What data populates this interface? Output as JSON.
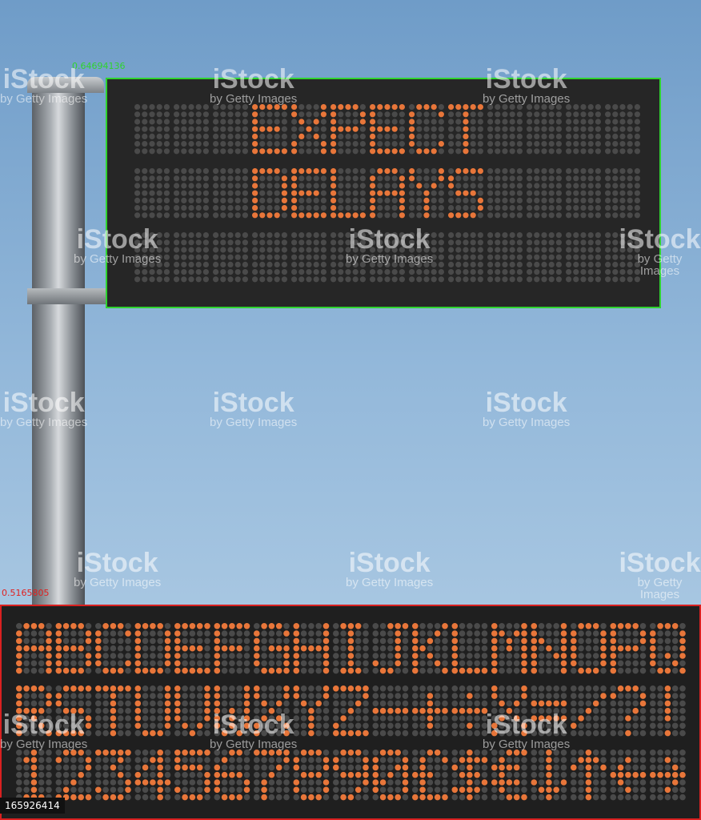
{
  "sign": {
    "lines": [
      "EXPECT",
      "DELAYS",
      ""
    ],
    "confidence": "0.64694136",
    "columns": 13
  },
  "font_panel": {
    "rows": [
      "ABCDEFGHIJKLMNOPQ",
      "RSTUVWXYZ-+÷X=/?!",
      "1234567890£$€↓↑←→"
    ],
    "confidence": "0.5165805"
  },
  "watermark": {
    "brand": "iStock",
    "credit": "by Getty Images"
  },
  "stock_id": "165926414",
  "colors": {
    "led_on": "#e8763a",
    "led_off": "#4a4a4a",
    "panel": "#262626",
    "sign_outline": "#2fd32f",
    "panel_outline": "#d92020"
  }
}
